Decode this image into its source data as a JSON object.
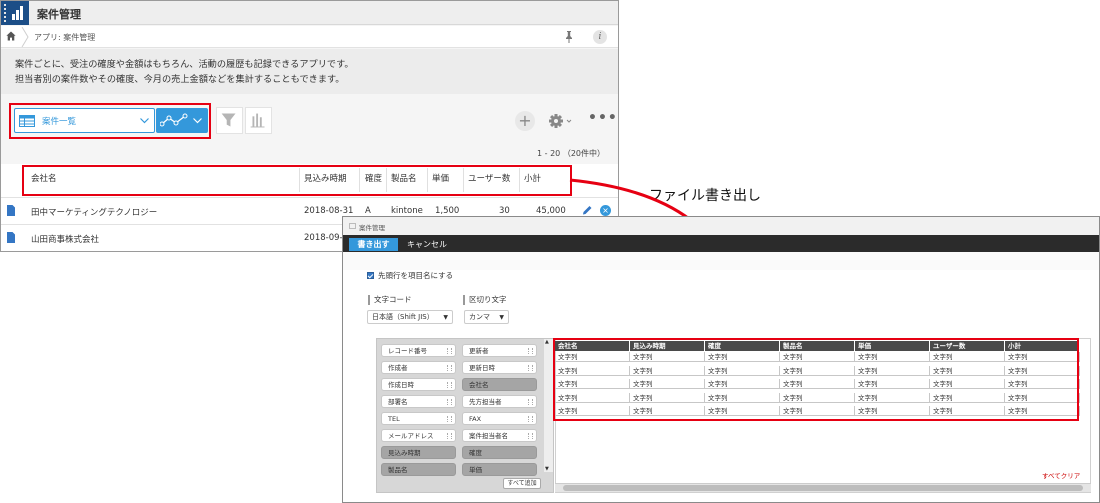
{
  "app": {
    "title": "案件管理",
    "breadcrumb": "アプリ: 案件管理",
    "info_icon": "i",
    "description": [
      "案件ごとに、受注の確度や金額はもちろん、活動の履歴も記録できるアプリです。",
      "担当者別の案件数やその確度、今月の売上金額などを集計することもできます。"
    ],
    "view": {
      "selected": "案件一覧"
    },
    "toolbar_icons": [
      "grid-icon",
      "line-chart-icon",
      "filter-icon",
      "bar-chart-icon",
      "plus-icon",
      "gear-icon",
      "more-icon"
    ],
    "add_symbol": "+",
    "more_symbol": "•••",
    "paging": "1 - 20 （20件中）",
    "columns": [
      "会社名",
      "見込み時期",
      "確度",
      "製品名",
      "単価",
      "ユーザー数",
      "小計"
    ],
    "rows": [
      {
        "company": "田中マーケティングテクノロジー",
        "date": "2018-08-31",
        "certainty": "A",
        "product": "kintone",
        "price": "1,500",
        "users": "30",
        "subtotal": "45,000"
      },
      {
        "company": "山田商事株式会社",
        "date": "2018-09-"
      }
    ],
    "delete_symbol": "×"
  },
  "caption": "ファイル書き出し",
  "export_dialog": {
    "title": "案件管理",
    "export_button": "書き出す",
    "cancel_button": "キャンセル",
    "header_checkbox_label": "先頭行を項目名にする",
    "header_checkbox_checked": true,
    "charset_label": "文字コード",
    "charset_value": "日本語（Shift JIS）",
    "delimiter_label": "区切り文字",
    "delimiter_value": "カンマ",
    "caret": "▼",
    "fields_left": [
      {
        "label": "レコード番号",
        "used": false
      },
      {
        "label": "作成者",
        "used": false
      },
      {
        "label": "作成日時",
        "used": false
      },
      {
        "label": "部署名",
        "used": false
      },
      {
        "label": "TEL",
        "used": false
      },
      {
        "label": "メールアドレス",
        "used": false
      },
      {
        "label": "見込み時期",
        "used": true
      },
      {
        "label": "製品名",
        "used": true
      }
    ],
    "fields_right": [
      {
        "label": "更新者",
        "used": false
      },
      {
        "label": "更新日時",
        "used": false
      },
      {
        "label": "会社名",
        "used": true
      },
      {
        "label": "先方担当者",
        "used": false
      },
      {
        "label": "FAX",
        "used": false
      },
      {
        "label": "案件担当者名",
        "used": false
      },
      {
        "label": "確度",
        "used": true
      },
      {
        "label": "単価",
        "used": true
      }
    ],
    "add_all_button": "すべて追加",
    "scroll_up": "▲",
    "scroll_down": "▼",
    "preview_columns": [
      "会社名",
      "見込み時期",
      "確度",
      "製品名",
      "単価",
      "ユーザー数",
      "小計"
    ],
    "preview_cell": "文字列",
    "preview_row_count": 5,
    "clear_all": "すべてクリア"
  }
}
